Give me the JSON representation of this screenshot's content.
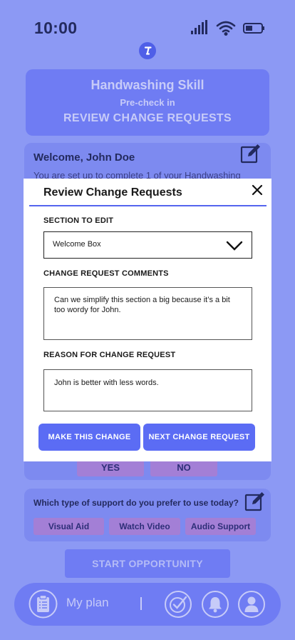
{
  "status_bar": {
    "time": "10:00",
    "icons": [
      "signal-icon",
      "wifi-icon",
      "battery-icon"
    ]
  },
  "header": {
    "title": "Handwashing Skill",
    "subtitle": "Pre-check in",
    "tag": "REVIEW CHANGE REQUESTS"
  },
  "welcome": {
    "title": "Welcome, John Doe",
    "text": "You are set up to complete 1 of your Handwashing"
  },
  "answers": {
    "yes_label": "YES",
    "no_label": "NO"
  },
  "support": {
    "question": "Which type of support do you prefer to use today?",
    "options": [
      "Visual Aid",
      "Watch Video",
      "Audio Support"
    ]
  },
  "start_button": "START OPPORTUNITY",
  "bottom_nav": {
    "plan_label": "My plan",
    "divider": "|"
  },
  "modal": {
    "title": "Review Change Requests",
    "section_label": "SECTION TO EDIT",
    "section_value": "Welcome Box",
    "comments_label": "CHANGE REQUEST COMMENTS",
    "comments_value": "Can we simplify this section a big because it’s a bit too wordy for John.",
    "reason_label": "REASON FOR CHANGE REQUEST",
    "reason_value": "John is better with less words.",
    "make_change_label": "MAKE THIS CHANGE",
    "next_request_label": "NEXT CHANGE REQUEST"
  },
  "colors": {
    "background": "#8c99f4",
    "card": "#6f7cf3",
    "accent_button": "#5b6cf4",
    "option_chip": "#a37fd6",
    "dark_text": "#232a5e"
  }
}
